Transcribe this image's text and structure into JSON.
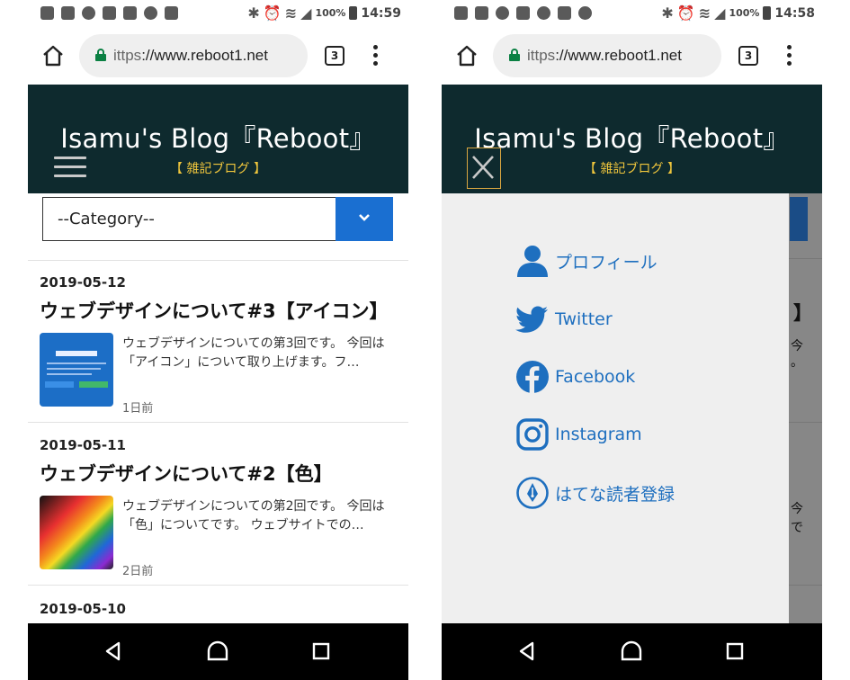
{
  "status_left": {
    "time": "14:59",
    "battery": "100%"
  },
  "status_right": {
    "time": "14:58",
    "battery": "100%"
  },
  "browser": {
    "url_scheme": "ittps",
    "url_rest": "://www.reboot1.net",
    "tabs_count": "3"
  },
  "site": {
    "title": "Isamu's Blog『Reboot』",
    "subtitle": "【 雑記ブログ 】"
  },
  "category_select": {
    "value": "--Category--"
  },
  "posts": [
    {
      "date": "2019-05-12",
      "title": "ウェブデザインについて#3【アイコン】",
      "excerpt": "ウェブデザインについての第3回です。 今回は「アイコン」について取り上げます。フ…",
      "ago": "1日前"
    },
    {
      "date": "2019-05-11",
      "title": "ウェブデザインについて#2【色】",
      "excerpt": "ウェブデザインについての第2回です。 今回は「色」についてです。 ウェブサイトでの…",
      "ago": "2日前"
    },
    {
      "date": "2019-05-10"
    }
  ],
  "peek": {
    "bracket": "】",
    "t1": "今",
    "t2": "。",
    "t3": "今",
    "t4": "で"
  },
  "drawer": {
    "items": [
      {
        "label": "プロフィール",
        "icon": "user-icon"
      },
      {
        "label": "Twitter",
        "icon": "twitter-icon"
      },
      {
        "label": "Facebook",
        "icon": "facebook-icon"
      },
      {
        "label": "Instagram",
        "icon": "instagram-icon"
      },
      {
        "label": "はてな読者登録",
        "icon": "hatena-icon"
      }
    ]
  },
  "colors": {
    "header_bg": "#0e2a2e",
    "subtitle": "#f0c63c",
    "accent_blue": "#1a6fd1",
    "link_blue": "#1e6fbf",
    "drawer_bg": "#efefef",
    "overlay": "#878787"
  }
}
